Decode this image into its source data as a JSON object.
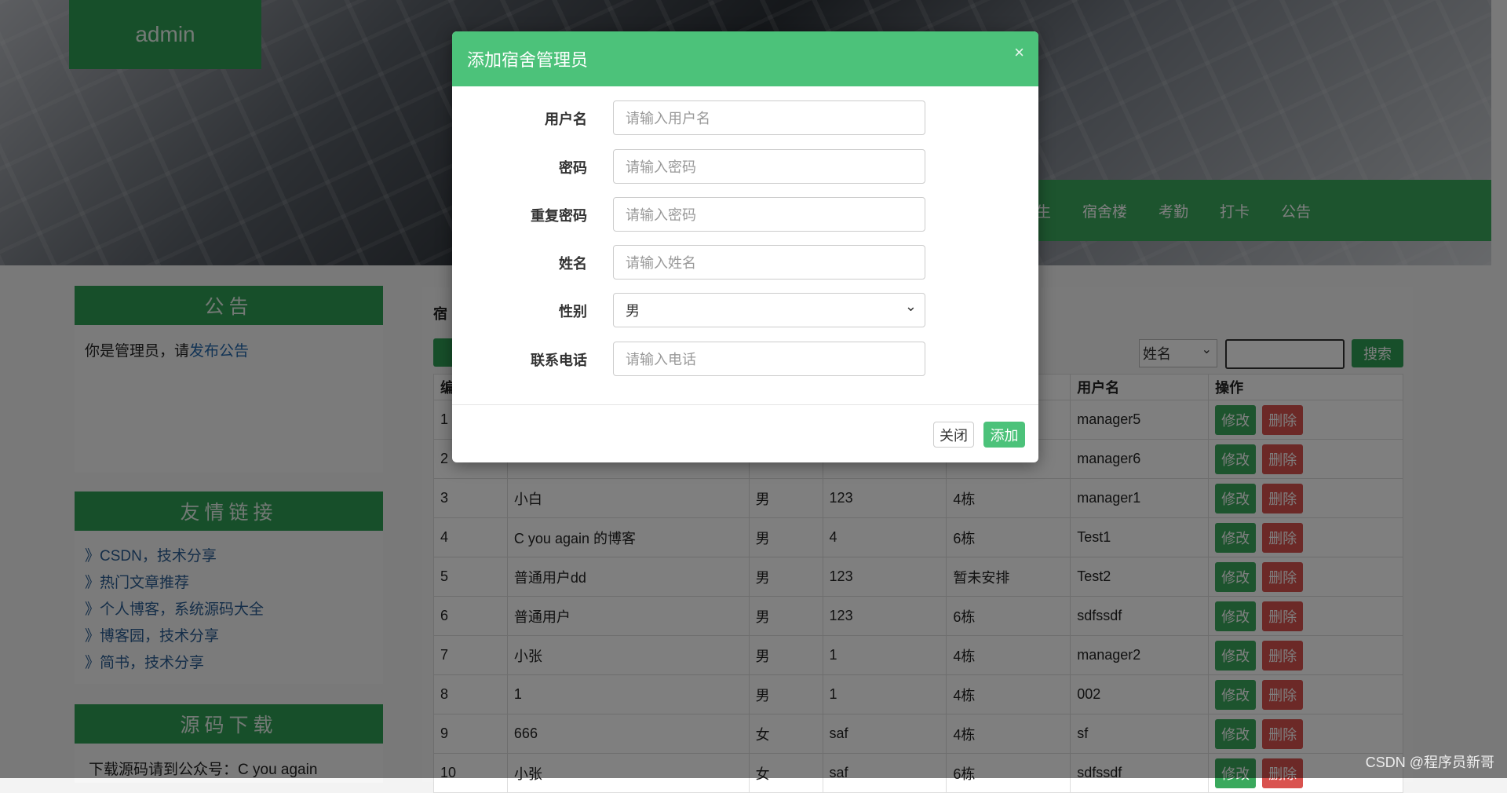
{
  "header": {
    "logo": "admin",
    "nav": [
      "生",
      "宿舍楼",
      "考勤",
      "打卡",
      "公告"
    ]
  },
  "sidebar": {
    "notice": {
      "title": "公告",
      "text": "你是管理员，请",
      "link": "发布公告"
    },
    "links": {
      "title": "友情链接",
      "items": [
        "》CSDN，技术分享",
        "》热门文章推荐",
        "》个人博客，系统源码大全",
        "》博客园，技术分享",
        "》简书，技术分享"
      ]
    },
    "source": {
      "title": "源码下载",
      "text": "下载源码请到公众号：C you again"
    }
  },
  "main": {
    "title": "宿",
    "add_label": "",
    "search": {
      "select_value": "姓名",
      "button": "搜索"
    },
    "table": {
      "headers": [
        "编",
        "",
        "",
        "",
        "",
        "用户名",
        "操作"
      ],
      "rows": [
        [
          "1",
          "",
          "",
          "",
          "",
          "manager5"
        ],
        [
          "2",
          "",
          "",
          "",
          "",
          "manager6"
        ],
        [
          "3",
          "小白",
          "男",
          "123",
          "4栋",
          "manager1"
        ],
        [
          "4",
          "C you again 的博客",
          "男",
          "4",
          "6栋",
          "Test1"
        ],
        [
          "5",
          "普通用户dd",
          "男",
          "123",
          "暂未安排",
          "Test2"
        ],
        [
          "6",
          "普通用户",
          "男",
          "123",
          "6栋",
          "sdfssdf"
        ],
        [
          "7",
          "小张",
          "男",
          "1",
          "4栋",
          "manager2"
        ],
        [
          "8",
          "1",
          "男",
          "1",
          "4栋",
          "002"
        ],
        [
          "9",
          "666",
          "女",
          "saf",
          "4栋",
          "sf"
        ],
        [
          "10",
          "小张",
          "女",
          "saf",
          "6栋",
          "sdfssdf"
        ]
      ],
      "edit_label": "修改",
      "delete_label": "删除"
    }
  },
  "modal": {
    "title": "添加宿舍管理员",
    "close_glyph": "×",
    "fields": {
      "username": {
        "label": "用户名",
        "placeholder": "请输入用户名"
      },
      "password": {
        "label": "密码",
        "placeholder": "请输入密码"
      },
      "repeat_password": {
        "label": "重复密码",
        "placeholder": "请输入密码"
      },
      "name": {
        "label": "姓名",
        "placeholder": "请输入姓名"
      },
      "gender": {
        "label": "性别",
        "value": "男"
      },
      "phone": {
        "label": "联系电话",
        "placeholder": "请输入电话"
      }
    },
    "close_button": "关闭",
    "add_button": "添加"
  },
  "watermark": "CSDN @程序员新哥"
}
